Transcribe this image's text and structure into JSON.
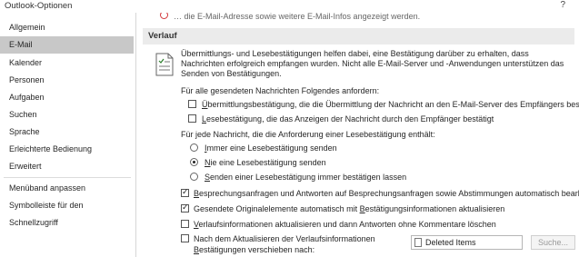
{
  "window": {
    "title": "Outlook-Optionen",
    "help": "?"
  },
  "sidebar": {
    "items": [
      {
        "label": "Allgemein"
      },
      {
        "label": "E-Mail"
      },
      {
        "label": "Kalender"
      },
      {
        "label": "Personen"
      },
      {
        "label": "Aufgaben"
      },
      {
        "label": "Suchen"
      },
      {
        "label": "Sprache"
      },
      {
        "label": "Erleichterte Bedienung"
      },
      {
        "label": "Erweitert"
      },
      {
        "label": "Menüband anpassen"
      },
      {
        "label": "Symbolleiste für den Schnellzugriff"
      }
    ],
    "selected": "E-Mail"
  },
  "main": {
    "partial_text": "… die E-Mail-Adresse sowie weitere E-Mail-Infos angezeigt werden.",
    "section_title": "Verlauf",
    "description": "Übermittlungs- und Lesebestätigungen helfen dabei, eine Bestätigung darüber zu erhalten, dass Nachrichten erfolgreich empfangen wurden. Nicht alle E-Mail-Server und -Anwendungen unterstützen das Senden von Bestätigungen.",
    "request_heading": "Für alle gesendeten Nachrichten Folgendes anfordern:",
    "cb_delivery": {
      "pre": "",
      "accel": "Ü",
      "post": "bermittlungsbestätigung, die die Übermittlung der Nachricht an den E-Mail-Server des Empfängers bestätigt",
      "checked": false
    },
    "cb_read": {
      "pre": "",
      "accel": "L",
      "post": "esebestätigung, die das Anzeigen der Nachricht durch den Empfänger bestätigt",
      "checked": false
    },
    "response_heading": "Für jede Nachricht, die die Anforderung einer Lesebestätigung enthält:",
    "rb_always": {
      "pre": "",
      "accel": "I",
      "post": "mmer eine Lesebestätigung senden",
      "checked": false
    },
    "rb_never": {
      "pre": "",
      "accel": "N",
      "post": "ie eine Lesebestätigung senden",
      "checked": true
    },
    "rb_ask": {
      "pre": "",
      "accel": "S",
      "post": "enden einer Lesebestätigung immer bestätigen lassen",
      "checked": false
    },
    "cb_meeting": {
      "pre": "",
      "accel": "B",
      "post": "esprechungsanfragen und Antworten auf Besprechungsanfragen sowie Abstimmungen automatisch bearbeiten",
      "checked": true
    },
    "cb_original": {
      "pre": "Gesendete Originalelemente automatisch mit ",
      "accel": "B",
      "post": "estätigungsinformationen aktualisieren",
      "checked": true
    },
    "cb_update": {
      "pre": "",
      "accel": "V",
      "post": "erlaufsinformationen aktualisieren und dann Antworten ohne Kommentare löschen",
      "checked": false
    },
    "cb_move_line1": "Nach dem Aktualisieren der Verlaufsinformationen",
    "cb_move_line2": {
      "pre": "",
      "accel": "B",
      "post": "estätigungen verschieben nach:",
      "checked": false
    },
    "folder": "Deleted Items",
    "search_button": "Suche..."
  }
}
